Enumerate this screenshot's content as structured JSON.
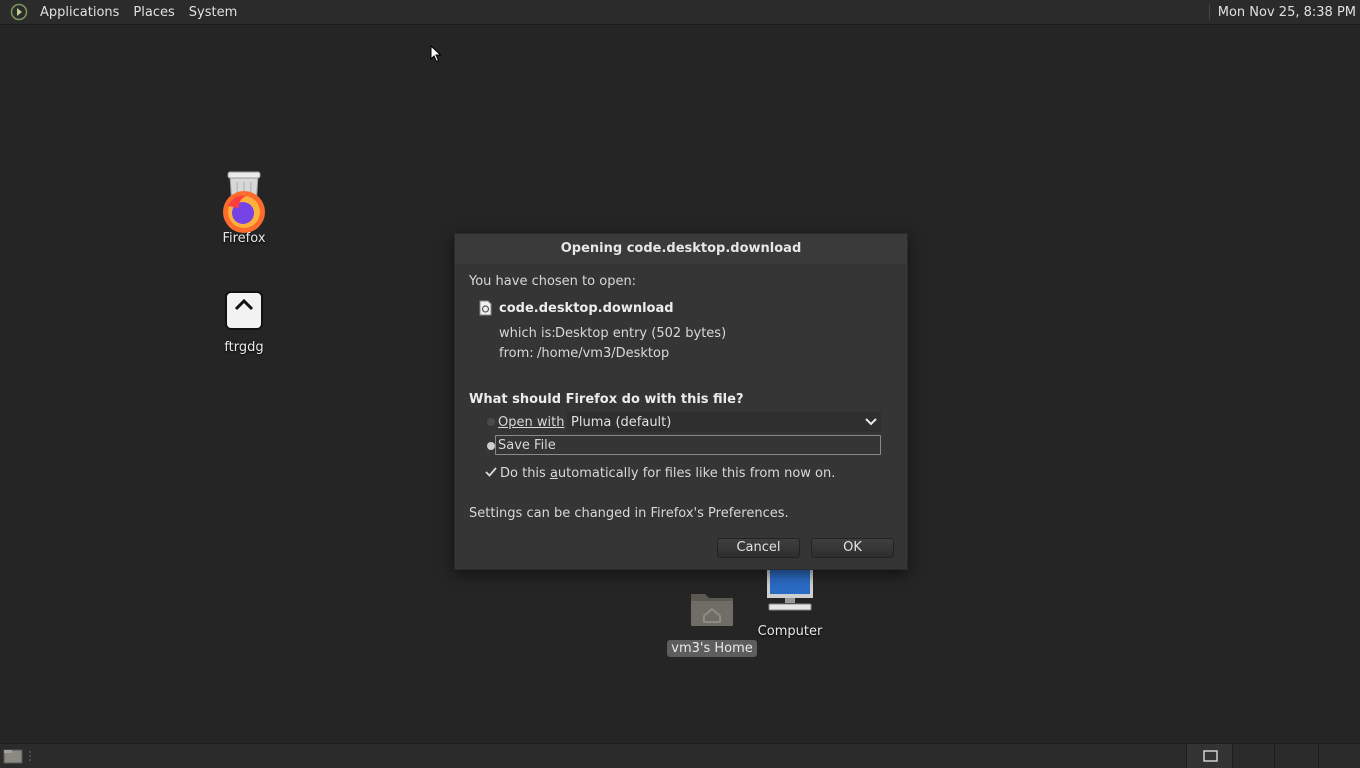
{
  "top_panel": {
    "menus": [
      "Applications",
      "Places",
      "System"
    ],
    "clock": "Mon Nov 25,  8:38 PM"
  },
  "desktop_icons": [
    {
      "label": "Firefox",
      "icon": "firefox-icon"
    },
    {
      "label": "ftrgdg",
      "icon": "launcher-icon"
    },
    {
      "label": "Computer",
      "icon": "computer-icon"
    },
    {
      "label": "vm3's Home",
      "icon": "home-folder-icon"
    }
  ],
  "dialog": {
    "title": "Opening code.desktop.download",
    "chosen_text": "You have chosen to open:",
    "file_name": "code.desktop.download",
    "which_is_label": "which is:",
    "which_is_value": "Desktop entry (502 bytes)",
    "from_label": "from:",
    "from_value": "/home/vm3/Desktop",
    "question": "What should Firefox do with this file?",
    "open_with_label": "Open with",
    "open_with_value": "Pluma (default)",
    "save_file_label": "Save File",
    "auto_label_pre": "Do this ",
    "auto_label_underlined": "a",
    "auto_label_post": "utomatically for files like this from now on.",
    "auto_checked": true,
    "selected_option": "Save File",
    "settings_note": "Settings can be changed in Firefox's Preferences.",
    "cancel_label": "Cancel",
    "ok_label": "OK"
  },
  "colors": {
    "desktop_bg": "#252525",
    "panel_bg": "#2b2b2b",
    "dialog_bg": "#353535"
  }
}
